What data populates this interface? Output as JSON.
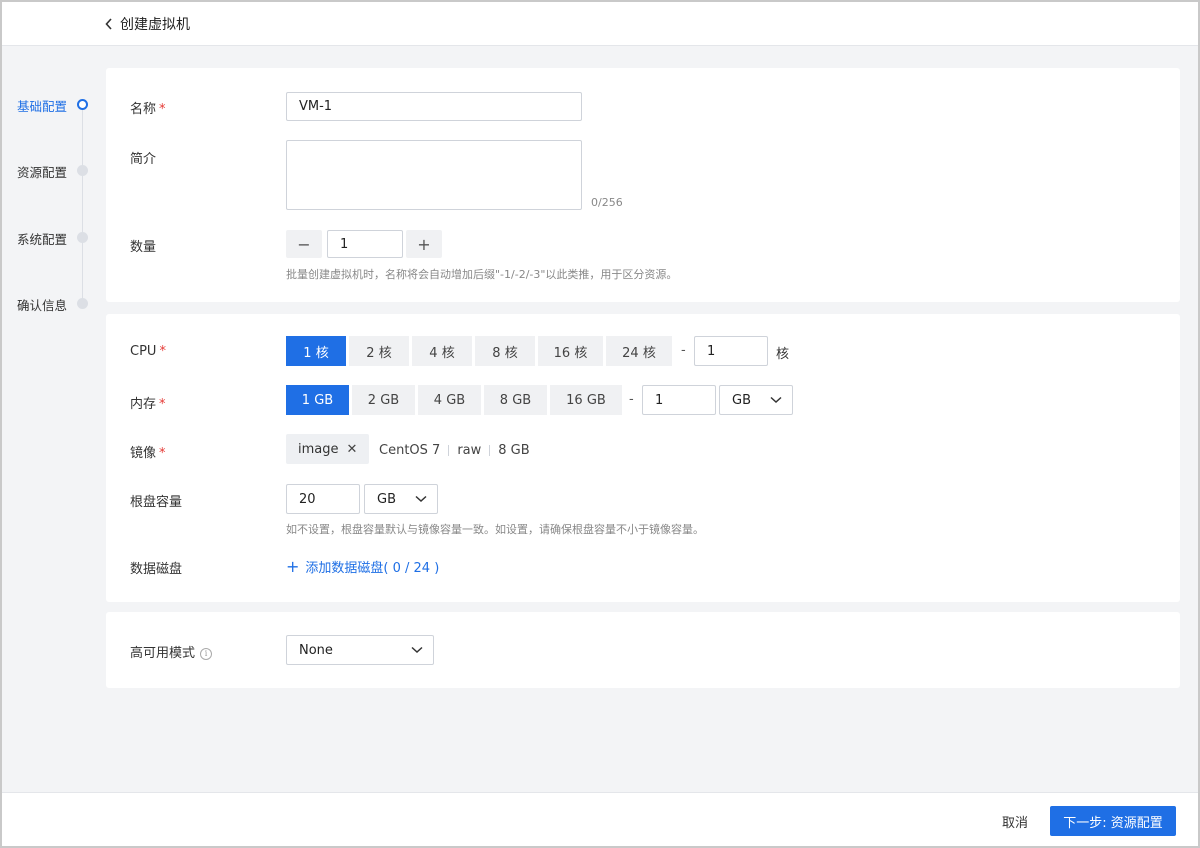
{
  "header": {
    "title": "创建虚拟机",
    "back_icon": "chevron-left-icon"
  },
  "steps": [
    {
      "label": "基础配置",
      "active": true
    },
    {
      "label": "资源配置",
      "active": false
    },
    {
      "label": "系统配置",
      "active": false
    },
    {
      "label": "确认信息",
      "active": false
    }
  ],
  "basic": {
    "name_label": "名称",
    "required_mark": "*",
    "name_value": "VM-1",
    "desc_label": "简介",
    "desc_counter": "0/256",
    "count_label": "数量",
    "count_value": "1",
    "count_minus": "−",
    "count_plus": "+",
    "count_hint": "批量创建虚拟机时，名称将会自动增加后缀\"-1/-2/-3\"以此类推，用于区分资源。"
  },
  "resource": {
    "cpu_label": "CPU",
    "cpu_options": [
      "1 核",
      "2 核",
      "4 核",
      "8 核",
      "16 核",
      "24 核"
    ],
    "cpu_selected": "1 核",
    "cpu_dash": "-",
    "cpu_custom": "1",
    "cpu_unit": "核",
    "mem_label": "内存",
    "mem_options": [
      "1 GB",
      "2 GB",
      "4 GB",
      "8 GB",
      "16 GB"
    ],
    "mem_selected": "1 GB",
    "mem_dash": "-",
    "mem_custom": "1",
    "mem_unit": "GB",
    "image_label": "镜像",
    "image_tag": "image",
    "image_close": "✕",
    "image_os": "CentOS 7",
    "image_format": "raw",
    "image_size": "8 GB",
    "rootdisk_label": "根盘容量",
    "rootdisk_value": "20",
    "rootdisk_unit": "GB",
    "rootdisk_hint": "如不设置，根盘容量默认与镜像容量一致。如设置，请确保根盘容量不小于镜像容量。",
    "datadisk_label": "数据磁盘",
    "datadisk_add": "+",
    "datadisk_link": "添加数据磁盘( 0 / 24 )"
  },
  "ha": {
    "label": "高可用模式",
    "info_icon": "i",
    "value": "None"
  },
  "footer": {
    "cancel": "取消",
    "next": "下一步: 资源配置"
  },
  "colors": {
    "accent": "#1f6fe5",
    "required": "#e53935"
  }
}
